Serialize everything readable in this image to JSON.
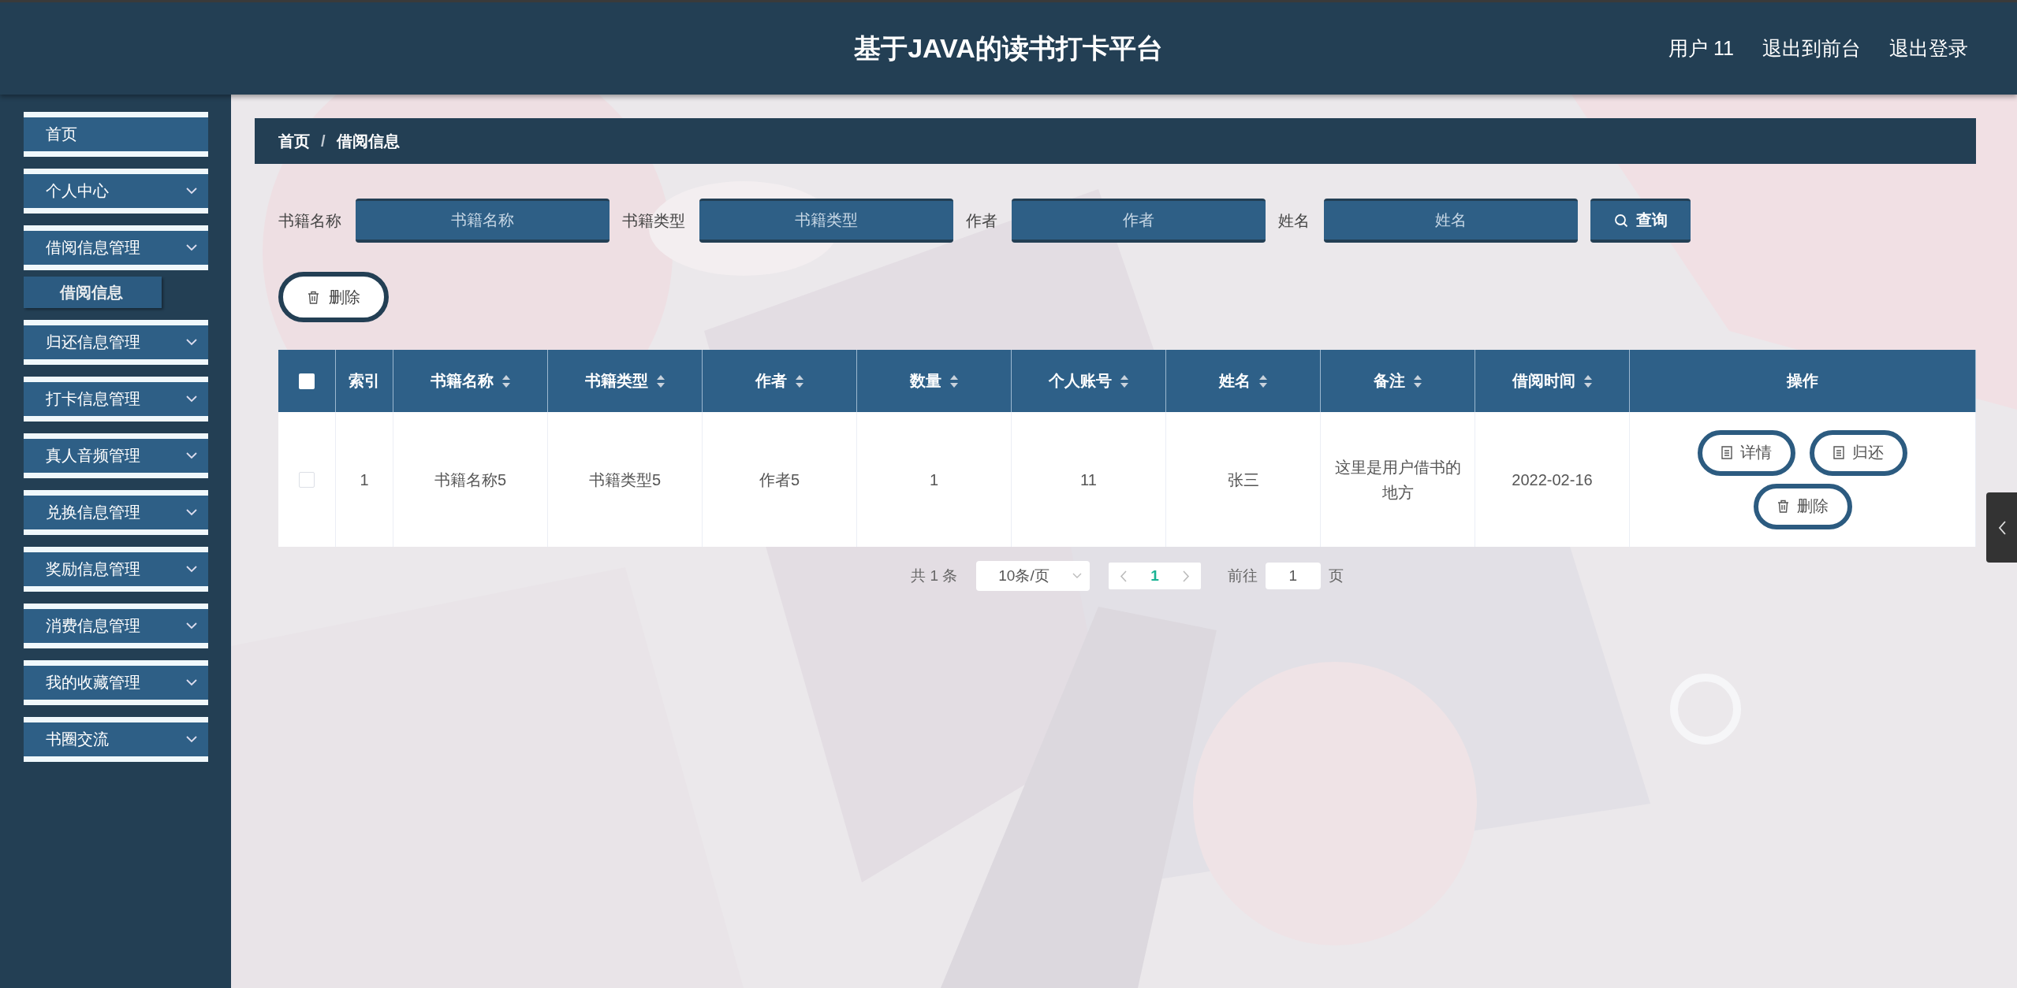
{
  "header": {
    "title": "基于JAVA的读书打卡平台",
    "links": [
      "用户 11",
      "退出到前台",
      "退出登录"
    ]
  },
  "sidebar": {
    "items": [
      {
        "label": "首页",
        "kind": "link"
      },
      {
        "label": "个人中心",
        "kind": "submenu"
      },
      {
        "label": "借阅信息管理",
        "kind": "submenu",
        "children": [
          {
            "label": "借阅信息",
            "selected": true
          }
        ]
      },
      {
        "label": "归还信息管理",
        "kind": "submenu"
      },
      {
        "label": "打卡信息管理",
        "kind": "submenu"
      },
      {
        "label": "真人音频管理",
        "kind": "submenu"
      },
      {
        "label": "兑换信息管理",
        "kind": "submenu"
      },
      {
        "label": "奖励信息管理",
        "kind": "submenu"
      },
      {
        "label": "消费信息管理",
        "kind": "submenu"
      },
      {
        "label": "我的收藏管理",
        "kind": "submenu"
      },
      {
        "label": "书圈交流",
        "kind": "submenu"
      }
    ]
  },
  "breadcrumb": {
    "items": [
      "首页",
      "借阅信息"
    ],
    "separator": "/"
  },
  "search": {
    "fields": [
      {
        "label": "书籍名称",
        "placeholder": "书籍名称"
      },
      {
        "label": "书籍类型",
        "placeholder": "书籍类型"
      },
      {
        "label": "作者",
        "placeholder": "作者"
      },
      {
        "label": "姓名",
        "placeholder": "姓名"
      }
    ],
    "button": "查询"
  },
  "delete_button": "删除",
  "table": {
    "select_all": {
      "checked": false
    },
    "columns": [
      {
        "label": "索引",
        "sortable": false
      },
      {
        "label": "书籍名称",
        "sortable": true
      },
      {
        "label": "书籍类型",
        "sortable": true
      },
      {
        "label": "作者",
        "sortable": true
      },
      {
        "label": "数量",
        "sortable": true
      },
      {
        "label": "个人账号",
        "sortable": true
      },
      {
        "label": "姓名",
        "sortable": true
      },
      {
        "label": "备注",
        "sortable": true
      },
      {
        "label": "借阅时间",
        "sortable": true
      },
      {
        "label": "操作",
        "sortable": false
      }
    ],
    "rows": [
      {
        "checked": false,
        "cells": [
          "1",
          "书籍名称5",
          "书籍类型5",
          "作者5",
          "1",
          "11",
          "张三",
          "这里是用户借书的地方",
          "2022-02-16"
        ],
        "actions": [
          {
            "label": "详情",
            "kind": "document"
          },
          {
            "label": "归还",
            "kind": "document"
          },
          {
            "label": "删除",
            "kind": "trash"
          }
        ]
      }
    ]
  },
  "pagination": {
    "total": "共 1 条",
    "page_size": "10条/页",
    "pages": [
      {
        "label": "1",
        "selected": true
      }
    ],
    "goto_label": "前往",
    "goto_value": "1",
    "page_unit": "页"
  }
}
